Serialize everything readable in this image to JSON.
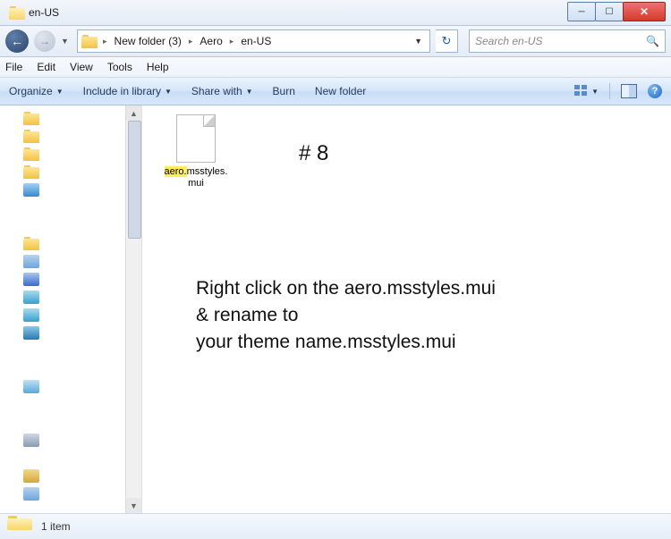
{
  "window": {
    "title": "en-US"
  },
  "breadcrumb": {
    "seg1": "New folder (3)",
    "seg2": "Aero",
    "seg3": "en-US"
  },
  "search": {
    "placeholder": "Search en-US"
  },
  "menubar": {
    "file": "File",
    "edit": "Edit",
    "view": "View",
    "tools": "Tools",
    "help": "Help"
  },
  "toolbar": {
    "organize": "Organize",
    "include": "Include in library",
    "share": "Share with",
    "burn": "Burn",
    "newfolder": "New folder"
  },
  "file": {
    "name_hl": "aero.",
    "name_rest": "msstyles.mui"
  },
  "overlay": {
    "step": "# 8",
    "line1": "Right click on the aero.msstyles.mui",
    "line2": "& rename to",
    "line3": "your theme name.msstyles.mui"
  },
  "status": {
    "count": "1 item"
  }
}
